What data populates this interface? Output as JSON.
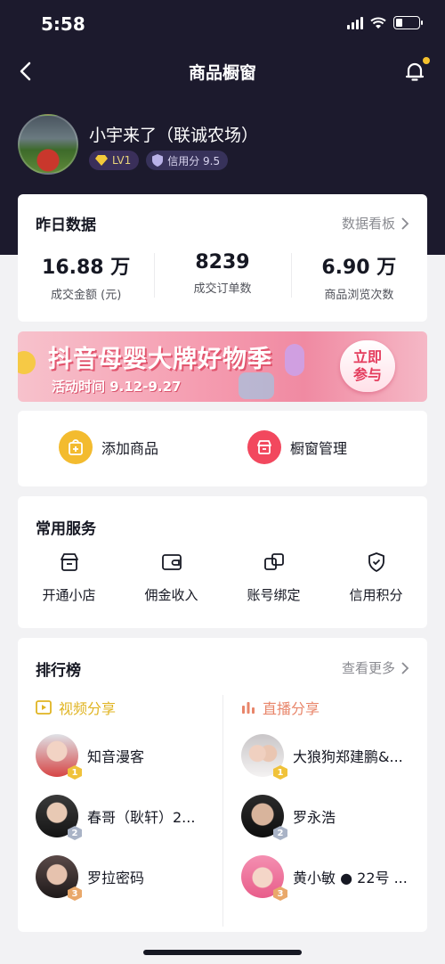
{
  "status_bar": {
    "time": "5:58"
  },
  "nav": {
    "title": "商品橱窗"
  },
  "profile": {
    "name": "小宇来了（联诚农场）",
    "level": "LV1",
    "credit": "信用分 9.5"
  },
  "data_card": {
    "title": "昨日数据",
    "link": "数据看板",
    "stats": [
      {
        "value": "16.88",
        "unit": "万",
        "label": "成交金额 (元)"
      },
      {
        "value": "8239",
        "unit": "",
        "label": "成交订单数"
      },
      {
        "value": "6.90",
        "unit": "万",
        "label": "商品浏览次数"
      }
    ]
  },
  "banner": {
    "title": "抖音母婴大牌好物季",
    "date": "活动时间 9.12-9.27",
    "button_line1": "立即",
    "button_line2": "参与"
  },
  "actions": {
    "add_product": "添加商品",
    "manage_window": "橱窗管理"
  },
  "services": {
    "title": "常用服务",
    "items": [
      {
        "label": "开通小店",
        "icon": "shop-icon"
      },
      {
        "label": "佣金收入",
        "icon": "wallet-icon"
      },
      {
        "label": "账号绑定",
        "icon": "link-icon"
      },
      {
        "label": "信用积分",
        "icon": "shield-icon"
      }
    ]
  },
  "ranking": {
    "title": "排行榜",
    "link": "查看更多",
    "video_tab": "视频分享",
    "live_tab": "直播分享",
    "video_list": [
      {
        "name": "知音漫客",
        "rank": "1"
      },
      {
        "name": "春哥（耿轩）2...",
        "rank": "2"
      },
      {
        "name": "罗拉密码",
        "rank": "3"
      }
    ],
    "live_list": [
      {
        "name": "大狼狗郑建鹏&...",
        "rank": "1"
      },
      {
        "name": "罗永浩",
        "rank": "2"
      },
      {
        "name": "黄小敏 ● 22号 ...",
        "rank": "3"
      }
    ]
  },
  "colors": {
    "hero": "#1c1a2d",
    "video_accent": "#e0b422",
    "live_accent": "#e8856a",
    "add_icon": "#f3bb2f",
    "manage_icon": "#f2485e"
  }
}
